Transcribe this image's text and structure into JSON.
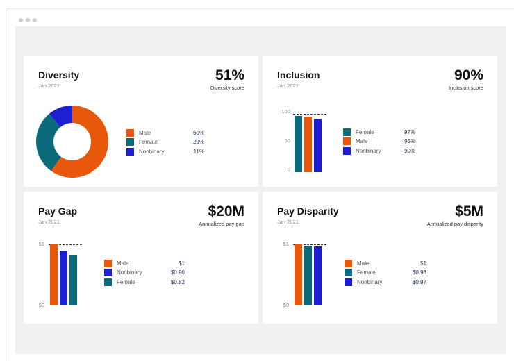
{
  "colors": {
    "Male": "#e8580c",
    "Female": "#0b6b7b",
    "Nonbinary": "#1d1fd1"
  },
  "cards": {
    "diversity": {
      "title": "Diversity",
      "date": "Jan 2021",
      "metric": "51%",
      "metric_label": "Diversity score",
      "legend": [
        {
          "name": "Male",
          "value": "60%"
        },
        {
          "name": "Female",
          "value": "29%"
        },
        {
          "name": "Nonbinary",
          "value": "11%"
        }
      ]
    },
    "inclusion": {
      "title": "Inclusion",
      "date": "Jan 2021",
      "metric": "90%",
      "metric_label": "Inclusion score",
      "legend": [
        {
          "name": "Female",
          "value": "97%"
        },
        {
          "name": "Male",
          "value": "95%"
        },
        {
          "name": "Nonbinary",
          "value": "90%"
        }
      ],
      "ticks": [
        "100",
        "50",
        "0"
      ]
    },
    "pay_gap": {
      "title": "Pay Gap",
      "date": "Jan 2021",
      "metric": "$20M",
      "metric_label": "Annualized pay gap",
      "legend": [
        {
          "name": "Male",
          "value": "$1"
        },
        {
          "name": "Nonbinary",
          "value": "$0.90"
        },
        {
          "name": "Female",
          "value": "$0.82"
        }
      ],
      "ticks": [
        "$1",
        "$0"
      ]
    },
    "pay_disparity": {
      "title": "Pay Disparity",
      "date": "Jan 2021",
      "metric": "$5M",
      "metric_label": "Annualized pay disparity",
      "legend": [
        {
          "name": "Male",
          "value": "$1"
        },
        {
          "name": "Female",
          "value": "$0.98"
        },
        {
          "name": "Nonbinary",
          "value": "$0.97"
        }
      ],
      "ticks": [
        "$1",
        "$0"
      ]
    }
  },
  "chart_data": [
    {
      "type": "pie",
      "categories": [
        "Male",
        "Female",
        "Nonbinary"
      ],
      "values": [
        60,
        29,
        11
      ],
      "title": "Diversity"
    },
    {
      "type": "bar",
      "categories": [
        "Female",
        "Male",
        "Nonbinary"
      ],
      "values": [
        97,
        95,
        90
      ],
      "ylim": [
        0,
        100
      ],
      "title": "Inclusion"
    },
    {
      "type": "bar",
      "categories": [
        "Male",
        "Nonbinary",
        "Female"
      ],
      "values": [
        1,
        0.9,
        0.82
      ],
      "ylim": [
        0,
        1
      ],
      "title": "Pay Gap"
    },
    {
      "type": "bar",
      "categories": [
        "Male",
        "Female",
        "Nonbinary"
      ],
      "values": [
        1,
        0.98,
        0.97
      ],
      "ylim": [
        0,
        1
      ],
      "title": "Pay Disparity"
    }
  ]
}
